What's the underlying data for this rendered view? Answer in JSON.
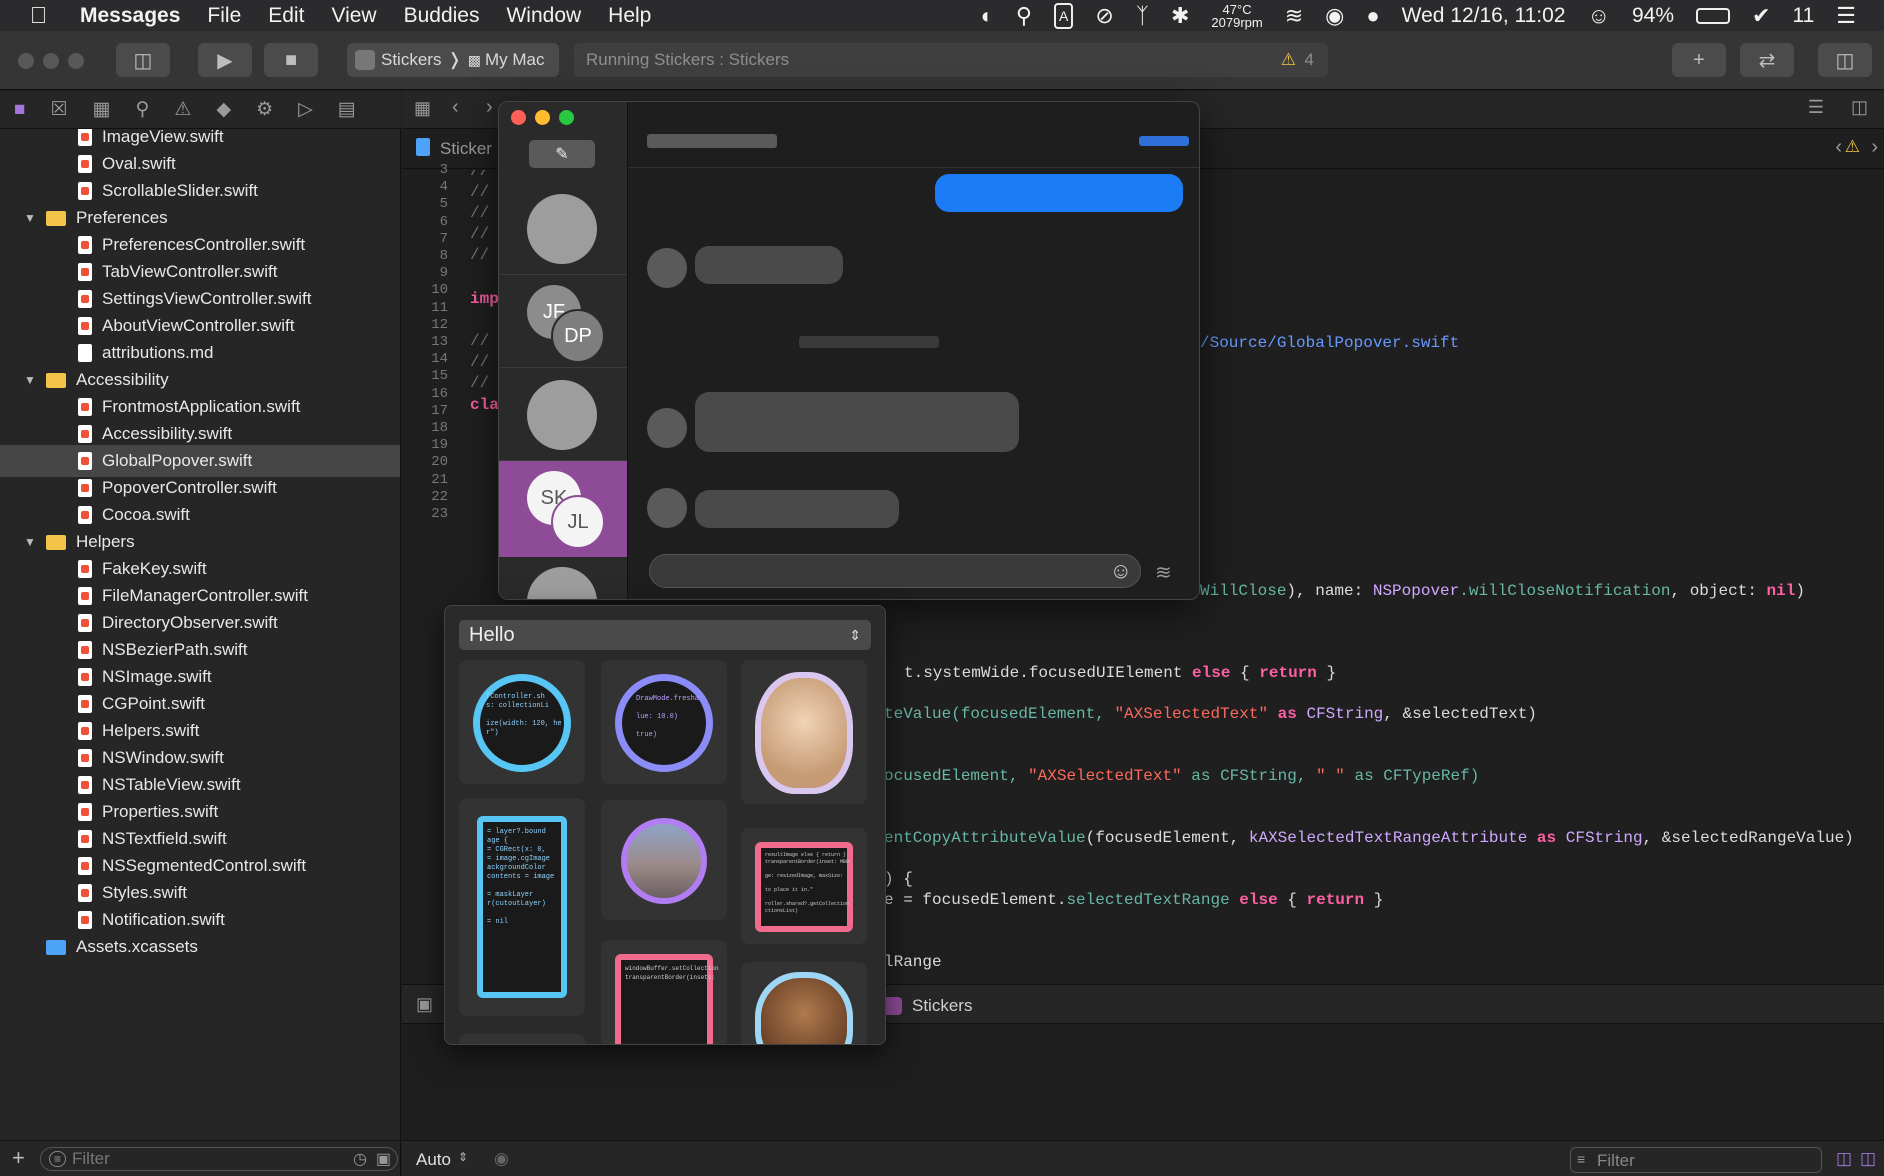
{
  "menubar": {
    "app": "Messages",
    "items": [
      "File",
      "Edit",
      "View",
      "Buddies",
      "Window",
      "Help"
    ],
    "temp": "47°C",
    "rpm": "2079rpm",
    "battery": "94%",
    "datetime": "Wed 12/16, 11:02",
    "notif_count": "11"
  },
  "toolbar": {
    "scheme": "Stickers",
    "destination": "My Mac",
    "activity": "Running Stickers : Stickers",
    "warnings": "4"
  },
  "editor": {
    "tab_label": "Sticker",
    "debug_target": "Stickers",
    "auto_label": "Auto",
    "filter_placeholder": "Filter"
  },
  "navigator": {
    "filter_placeholder": "Filter",
    "rows": [
      {
        "label": "ImageView.swift",
        "kind": "swift",
        "depth": 2
      },
      {
        "label": "Oval.swift",
        "kind": "swift",
        "depth": 2
      },
      {
        "label": "ScrollableSlider.swift",
        "kind": "swift",
        "depth": 2
      },
      {
        "label": "Preferences",
        "kind": "folder",
        "depth": 1
      },
      {
        "label": "PreferencesController.swift",
        "kind": "swift",
        "depth": 2
      },
      {
        "label": "TabViewController.swift",
        "kind": "swift",
        "depth": 2
      },
      {
        "label": "SettingsViewController.swift",
        "kind": "swift",
        "depth": 2
      },
      {
        "label": "AboutViewController.swift",
        "kind": "swift",
        "depth": 2
      },
      {
        "label": "attributions.md",
        "kind": "file",
        "depth": 2
      },
      {
        "label": "Accessibility",
        "kind": "folder",
        "depth": 1
      },
      {
        "label": "FrontmostApplication.swift",
        "kind": "swift",
        "depth": 2
      },
      {
        "label": "Accessibility.swift",
        "kind": "swift",
        "depth": 2
      },
      {
        "label": "GlobalPopover.swift",
        "kind": "swift",
        "depth": 2,
        "selected": true
      },
      {
        "label": "PopoverController.swift",
        "kind": "swift",
        "depth": 2
      },
      {
        "label": "Cocoa.swift",
        "kind": "swift",
        "depth": 2
      },
      {
        "label": "Helpers",
        "kind": "folder",
        "depth": 1
      },
      {
        "label": "FakeKey.swift",
        "kind": "swift",
        "depth": 2
      },
      {
        "label": "FileManagerController.swift",
        "kind": "swift",
        "depth": 2
      },
      {
        "label": "DirectoryObserver.swift",
        "kind": "swift",
        "depth": 2
      },
      {
        "label": "NSBezierPath.swift",
        "kind": "swift",
        "depth": 2
      },
      {
        "label": "NSImage.swift",
        "kind": "swift",
        "depth": 2
      },
      {
        "label": "CGPoint.swift",
        "kind": "swift",
        "depth": 2
      },
      {
        "label": "Helpers.swift",
        "kind": "swift",
        "depth": 2
      },
      {
        "label": "NSWindow.swift",
        "kind": "swift",
        "depth": 2
      },
      {
        "label": "NSTableView.swift",
        "kind": "swift",
        "depth": 2
      },
      {
        "label": "Properties.swift",
        "kind": "swift",
        "depth": 2
      },
      {
        "label": "NSTextfield.swift",
        "kind": "swift",
        "depth": 2
      },
      {
        "label": "NSSegmentedControl.swift",
        "kind": "swift",
        "depth": 2
      },
      {
        "label": "Styles.swift",
        "kind": "swift",
        "depth": 2
      },
      {
        "label": "Notification.swift",
        "kind": "swift",
        "depth": 2
      },
      {
        "label": "Assets.xcassets",
        "kind": "assets",
        "depth": 1
      }
    ]
  },
  "code": {
    "line_numbers": [
      "3",
      "4",
      "5",
      "6",
      "7",
      "8",
      "9",
      "10",
      "11",
      "12",
      "13",
      "14",
      "15",
      "16",
      "17",
      "18",
      "19",
      "20",
      "21",
      "22",
      "23"
    ],
    "fragments": {
      "c1": "//",
      "c2": "//",
      "c3": "//",
      "c4": "//",
      "c5": "//",
      "imp": "imp",
      "c6": "//",
      "c7": "//",
      "c8": "//",
      "cla": "cla",
      "path": "/Source/GlobalPopover.swift",
      "will_close_a": "WillClose",
      "will_close_b": "), name: ",
      "will_close_c": "NSPopover",
      "will_close_d": ".willCloseNotification",
      "will_close_e": ", object: ",
      "will_close_f": "nil",
      "will_close_g": ")",
      "sys_a": "t.systemWide.focusedUIElement ",
      "sys_b": "else",
      "sys_c": " { ",
      "sys_d": "return",
      "sys_e": " }",
      "val_a": "teValue(focusedElement, ",
      "val_b": "\"AXSelectedText\"",
      "val_c": " as ",
      "val_d": "CFString",
      "val_e": ", &selectedText)",
      "foc_a": "ocusedElement, ",
      "foc_b": "\"AXSelectedText\"",
      "foc_c": " as CFString, ",
      "foc_d": "\" \"",
      "foc_e": " as CFTypeRef)",
      "copy_a": "entCopyAttributeValue",
      "copy_b": "(focusedElement, ",
      "copy_c": "kAXSelectedTextRangeAttribute",
      "copy_d": " as ",
      "copy_e": "CFString",
      "copy_f": ", &selectedRangeValue)",
      "brace": ") {",
      "eq_a": "e = focusedElement.",
      "eq_b": "selectedTextRange",
      "eq_c": " else",
      "eq_d": " { ",
      "eq_e": "return",
      "eq_f": " }",
      "range": "lRange"
    }
  },
  "messages": {
    "contacts": [
      {
        "initials_front": "JF",
        "initials_back": "DP"
      },
      {
        "initials_front": "SK",
        "initials_back": "JL"
      }
    ]
  },
  "stickers": {
    "pack_name": "Hello",
    "code_snippets": {
      "ring1": "fController.sh\ns: collectionLi\n\nize(width: 120, he\nr\")",
      "ring2": "DrawMode.fresha\n\nlue: 10.0)\n\ntrue)",
      "tall": "= layer?.bound\nage {\n= CGRect(x: 0,\n= image.cgImage\nackgroundColor\ncontents = image\n\n= maskLayer\nr(cutoutLayer)\n\n= nil",
      "pink1": "resultImage else { return }\ntransparentBorder(inset: MBO\n\nge: resizedImage, maxSize:\n\nto place it in.\"\n\nroller.shared?.getCollection\nctionsList)",
      "pink2": "windowBuffer.setCollection\ntransparentBorder(insets:\n"
    }
  },
  "colors": {
    "accent_purple": "#8e4b97",
    "ring_blue": "#57c6f5",
    "ring_violet": "#8b8cf7",
    "pink": "#f06b8c"
  }
}
